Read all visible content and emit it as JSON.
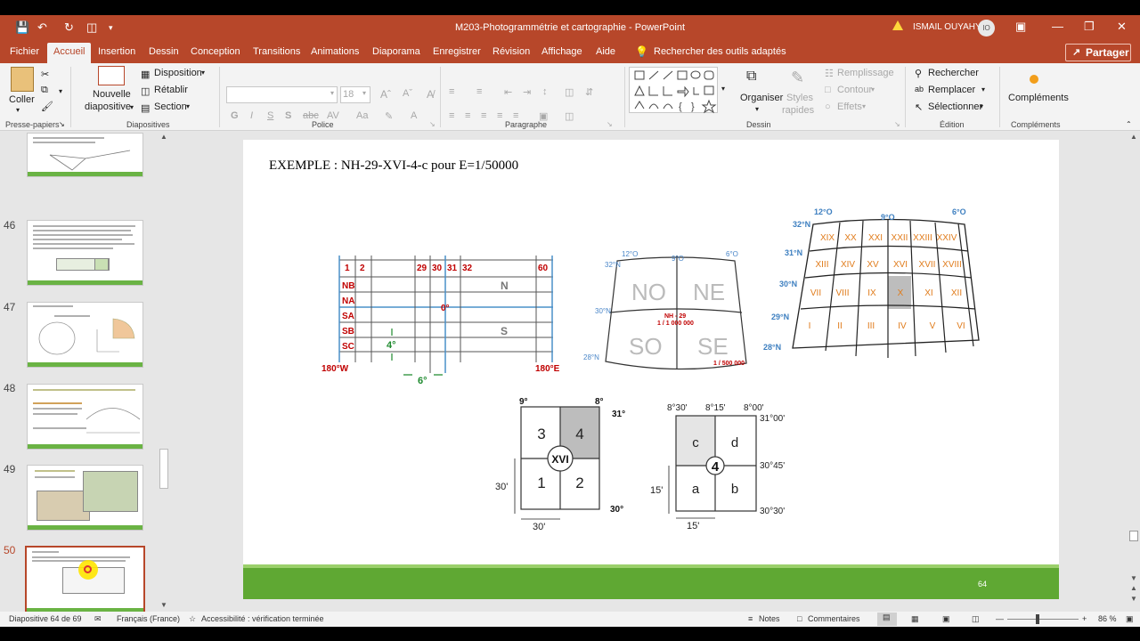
{
  "window": {
    "title": "M203-Photogrammétrie et cartographie  -  PowerPoint",
    "user": "ISMAIL OUYAHYA",
    "avatar_initials": "IO"
  },
  "tabs": [
    "Fichier",
    "Accueil",
    "Insertion",
    "Dessin",
    "Conception",
    "Transitions",
    "Animations",
    "Diaporama",
    "Enregistrer",
    "Révision",
    "Affichage",
    "Aide"
  ],
  "active_tab": "Accueil",
  "search_tools": "Rechercher des outils adaptés",
  "share_label": "Partager",
  "ribbon": {
    "clipboard": {
      "paste": "Coller",
      "label": "Presse-papiers"
    },
    "slides": {
      "new_slide_1": "Nouvelle",
      "new_slide_2": "diapositive",
      "layout": "Disposition",
      "reset": "Rétablir",
      "section": "Section",
      "label": "Diapositives"
    },
    "font": {
      "size": "18",
      "label": "Police"
    },
    "paragraph": {
      "label": "Paragraphe"
    },
    "drawing": {
      "arrange": "Organiser",
      "quick_styles_1": "Styles",
      "quick_styles_2": "rapides",
      "fill": "Remplissage",
      "outline": "Contour",
      "effects": "Effets",
      "label": "Dessin"
    },
    "editing": {
      "find": "Rechercher",
      "replace": "Remplacer",
      "select": "Sélectionner",
      "label": "Édition"
    },
    "addins": {
      "button": "Compléments",
      "label": "Compléments"
    }
  },
  "thumbnails": [
    {
      "num": ""
    },
    {
      "num": "46"
    },
    {
      "num": "47"
    },
    {
      "num": "48"
    },
    {
      "num": "49"
    },
    {
      "num": "50"
    }
  ],
  "slide": {
    "heading": "EXEMPLE : NH-29-XVI-4-c pour E=1/50000",
    "page_number": "64",
    "grid": {
      "columns": [
        "1",
        "2",
        "29",
        "30",
        "31",
        "32",
        "60"
      ],
      "rows": [
        "NB",
        "NA",
        "SA",
        "SB",
        "SC"
      ],
      "equator": "0°",
      "cell_height": "4°",
      "cell_width": "6°",
      "west": "180°W",
      "east": "180°E",
      "north_label": "N",
      "south_label": "S"
    },
    "sheet": {
      "top_left": "12°O",
      "top_mid": "9°O",
      "top_right": "6°O",
      "lat_top": "32°N",
      "lat_mid": "30°N",
      "lat_bot": "28°N",
      "quads": [
        "NO",
        "NE",
        "SO",
        "SE"
      ],
      "name": "NH - 29",
      "scale_top": "1 / 1 000 000",
      "scale_bottom": "1 / 500 000"
    },
    "roman": {
      "top_left": "12°O",
      "top_mid": "9°O",
      "top_right": "6°O",
      "lats": [
        "32°N",
        "31°N",
        "30°N",
        "29°N",
        "28°N"
      ],
      "cells": [
        "XIX",
        "XX",
        "XXI",
        "XXII",
        "XXIII",
        "XXIV",
        "XIII",
        "XIV",
        "XV",
        "XVI",
        "XVII",
        "XVIII",
        "VII",
        "VIII",
        "IX",
        "X",
        "XI",
        "XII",
        "I",
        "II",
        "III",
        "IV",
        "V",
        "VI"
      ],
      "highlight": "XVI"
    },
    "quad1": {
      "left_top": "9°",
      "right_top": "8°",
      "lat_top": "31°",
      "lat_bot": "30°",
      "cells": [
        "3",
        "4",
        "1",
        "2"
      ],
      "center": "XVI",
      "side": "30'",
      "bottom": "30'"
    },
    "quad2": {
      "left_top": "8°30'",
      "mid_top": "8°15'",
      "right_top": "8°00'",
      "lat_top": "31°00'",
      "lat_mid": "30°45'",
      "lat_bot": "30°30'",
      "cells": [
        "c",
        "d",
        "a",
        "b"
      ],
      "center": "4",
      "side": "15'",
      "bottom": "15'"
    }
  },
  "status": {
    "slide_info": "Diapositive 64 de 69",
    "language": "Français (France)",
    "accessibility": "Accessibilité : vérification terminée",
    "notes": "Notes",
    "comments": "Commentaires",
    "zoom": "86 %"
  },
  "colors": {
    "accent": "#b7472a",
    "green": "#5fa833",
    "red_label": "#c00000",
    "blue_label": "#4a86c8",
    "orange_label": "#e07b1a"
  }
}
